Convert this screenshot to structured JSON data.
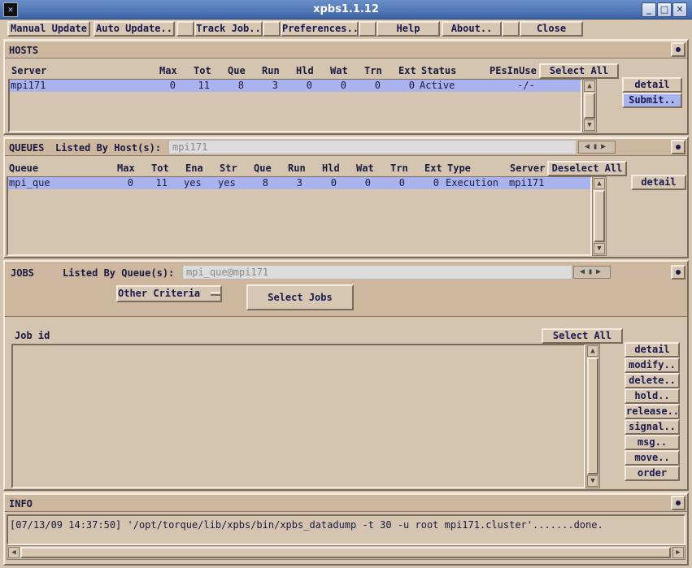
{
  "window": {
    "title": "xpbs1.1.12"
  },
  "menu": {
    "manual_update": "Manual Update",
    "auto_update": "Auto Update..",
    "track_job": "Track Job..",
    "preferences": "Preferences..",
    "help": "Help",
    "about": "About..",
    "close": "Close"
  },
  "hosts": {
    "section_label": "HOSTS",
    "columns": [
      "Server",
      "Max",
      "Tot",
      "Que",
      "Run",
      "Hld",
      "Wat",
      "Trn",
      "Ext",
      "Status",
      "PEsInUse"
    ],
    "select_all": "Select All",
    "detail": "detail",
    "submit": "Submit..",
    "rows": [
      {
        "server": "mpi171",
        "max": "0",
        "tot": "11",
        "que": "8",
        "run": "3",
        "hld": "0",
        "wat": "0",
        "trn": "0",
        "ext": "0",
        "status": "Active",
        "pes": "-/-"
      }
    ]
  },
  "queues": {
    "section_label": "QUEUES",
    "listed_by_label": "Listed By Host(s):",
    "listed_by_value": "mpi171",
    "columns": [
      "Queue",
      "Max",
      "Tot",
      "Ena",
      "Str",
      "Que",
      "Run",
      "Hld",
      "Wat",
      "Trn",
      "Ext",
      "Type",
      "Server"
    ],
    "deselect_all": "Deselect All",
    "detail": "detail",
    "rows": [
      {
        "queue": "mpi_que",
        "max": "0",
        "tot": "11",
        "ena": "yes",
        "str": "yes",
        "que": "8",
        "run": "3",
        "hld": "0",
        "wat": "0",
        "trn": "0",
        "ext": "0",
        "type": "Execution",
        "server": "mpi171"
      }
    ]
  },
  "jobs": {
    "section_label": "JOBS",
    "listed_by_label": "Listed By Queue(s):",
    "listed_by_value": "mpi_que@mpi171",
    "other_criteria": "Other Criteria",
    "select_jobs": "Select Jobs",
    "job_id_label": "Job id",
    "select_all": "Select All",
    "actions": [
      "detail",
      "modify..",
      "delete..",
      "hold..",
      "release..",
      "signal..",
      "msg..",
      "move..",
      "order"
    ]
  },
  "info": {
    "section_label": "INFO",
    "log": "[07/13/09 14:37:50] '/opt/torque/lib/xpbs/bin/xpbs_datadump -t 30 -u root  mpi171.cluster'.......done."
  },
  "colors": {
    "background": "#d4c4b0",
    "selection": "#a9b3ee",
    "titlebar": "#4a72b5"
  }
}
